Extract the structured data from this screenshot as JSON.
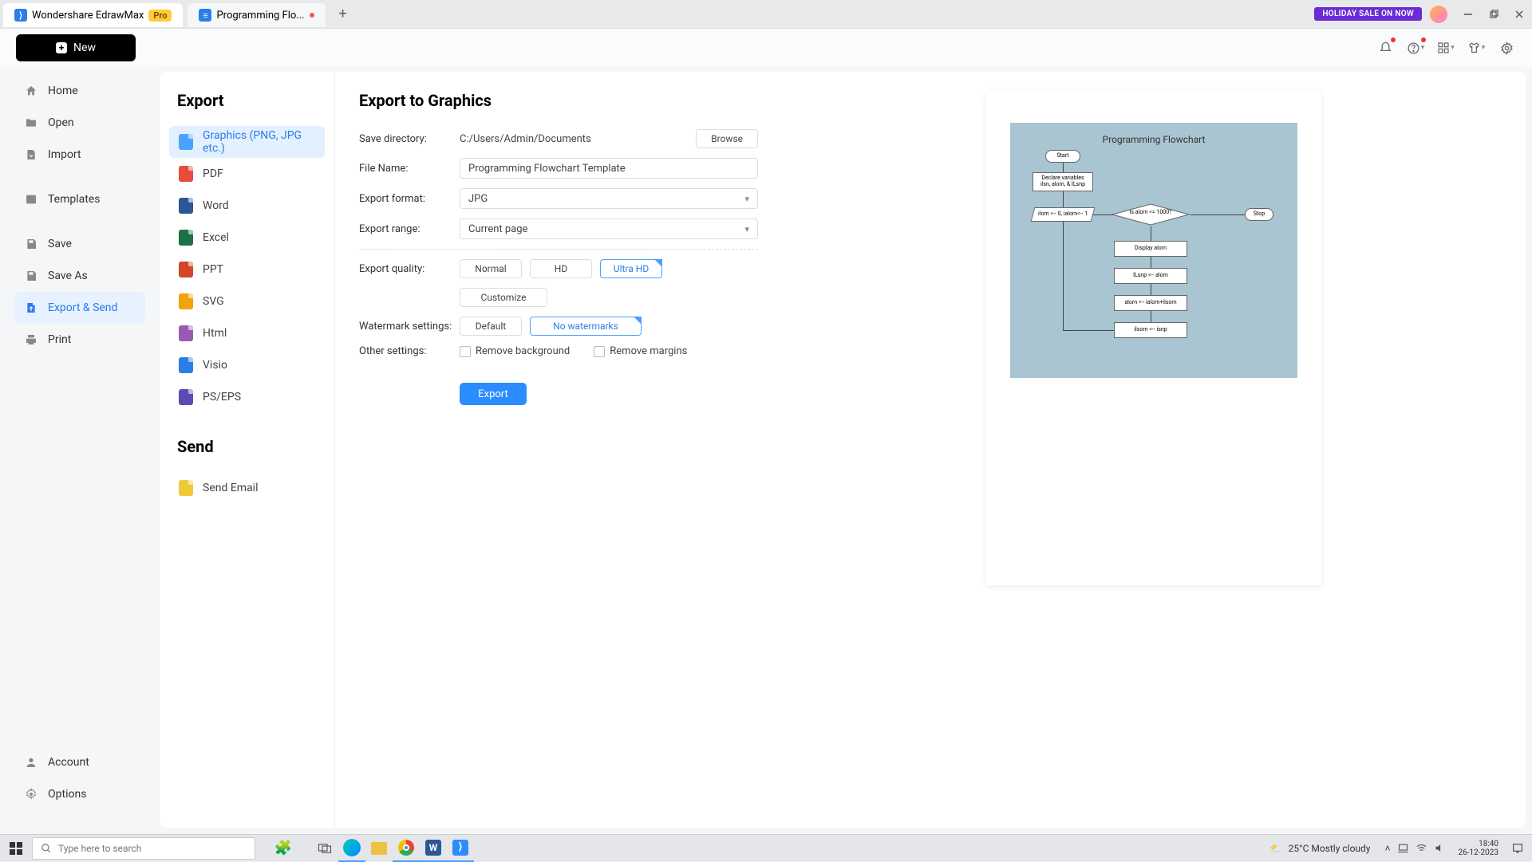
{
  "titlebar": {
    "tab1_label": "Wondershare EdrawMax",
    "pro_badge": "Pro",
    "tab2_label": "Programming Flo...",
    "promo": "HOLIDAY SALE ON NOW"
  },
  "toolbar": {
    "new_label": "New"
  },
  "sidebar": {
    "items": [
      {
        "label": "Home"
      },
      {
        "label": "Open"
      },
      {
        "label": "Import"
      },
      {
        "label": "Templates"
      },
      {
        "label": "Save"
      },
      {
        "label": "Save As"
      },
      {
        "label": "Export & Send"
      },
      {
        "label": "Print"
      },
      {
        "label": "Account"
      },
      {
        "label": "Options"
      }
    ]
  },
  "exportnav": {
    "title": "Export",
    "items": [
      {
        "label": "Graphics (PNG, JPG etc.)",
        "color": "#4aa3ff"
      },
      {
        "label": "PDF",
        "color": "#e74c3c"
      },
      {
        "label": "Word",
        "color": "#2b5797"
      },
      {
        "label": "Excel",
        "color": "#1e7145"
      },
      {
        "label": "PPT",
        "color": "#d24726"
      },
      {
        "label": "SVG",
        "color": "#f0a30a"
      },
      {
        "label": "Html",
        "color": "#9b59b6"
      },
      {
        "label": "Visio",
        "color": "#2b7de9"
      },
      {
        "label": "PS/EPS",
        "color": "#5b4db0"
      }
    ],
    "send_title": "Send",
    "send_item": "Send Email"
  },
  "settings": {
    "title": "Export to Graphics",
    "save_dir_lbl": "Save directory:",
    "save_dir_val": "C:/Users/Admin/Documents",
    "browse_btn": "Browse",
    "filename_lbl": "File Name:",
    "filename_val": "Programming Flowchart Template",
    "format_lbl": "Export format:",
    "format_val": "JPG",
    "range_lbl": "Export range:",
    "range_val": "Current page",
    "quality_lbl": "Export quality:",
    "quality_opts": [
      "Normal",
      "HD",
      "Ultra HD"
    ],
    "customize_btn": "Customize",
    "watermark_lbl": "Watermark settings:",
    "watermark_opts": [
      "Default",
      "No watermarks"
    ],
    "other_lbl": "Other settings:",
    "other_opts": [
      "Remove background",
      "Remove margins"
    ],
    "export_btn": "Export"
  },
  "preview": {
    "title": "Programming Flowchart",
    "start": "Start",
    "declare": "Declare variables ilsn, alorn, & ILsnp",
    "input": "ilorn <-- 0, ialorn<-- 1",
    "cond": "Is alorn <= 1000?",
    "stop": "Stop",
    "p1": "Display alorn",
    "p2": "ILsnp <-- alorn",
    "p3": "alorn <-- ialorn+ilsorn",
    "p4": "ilsorn <-- isnp"
  },
  "taskbar": {
    "search_placeholder": "Type here to search",
    "weather": "25°C  Mostly cloudy",
    "time": "18:40",
    "date": "26-12-2023"
  }
}
